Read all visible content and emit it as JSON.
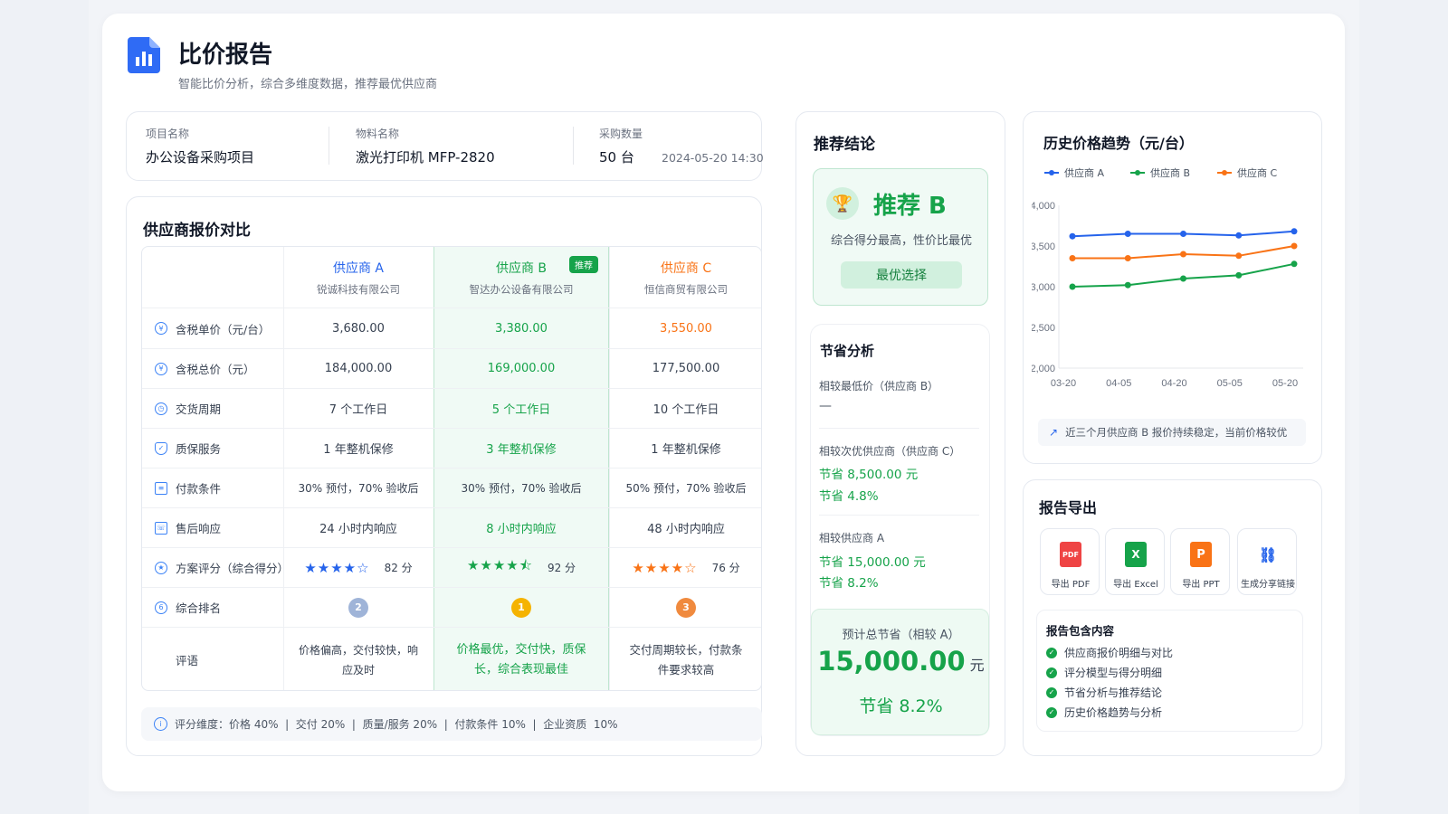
{
  "header": {
    "title": "比价报告",
    "subtitle": "智能比价分析，综合多维度数据，推荐最优供应商"
  },
  "project_info": {
    "project_label": "项目名称",
    "project_value": "办公设备采购项目",
    "material_label": "物料名称",
    "material_value": "激光打印机 MFP-2820",
    "qty_label": "采购数量",
    "qty_value": "50 台",
    "datetime": "2024-05-20 14:30"
  },
  "comparison": {
    "title": "供应商报价对比",
    "suppliers": [
      {
        "name": "供应商 A",
        "company": "锐诚科技有限公司"
      },
      {
        "name": "供应商 B",
        "company": "智达办公设备有限公司",
        "tag": "推荐"
      },
      {
        "name": "供应商 C",
        "company": "恒信商贸有限公司"
      }
    ],
    "rows": [
      {
        "label": "含税单价（元/台）",
        "icon": "money-icon",
        "a": "3,680.00",
        "b": "3,380.00",
        "c": "3,550.00"
      },
      {
        "label": "含税总价（元）",
        "icon": "money-icon",
        "a": "184,000.00",
        "b": "169,000.00",
        "c": "177,500.00"
      },
      {
        "label": "交货周期",
        "icon": "clock-icon",
        "a": "7 个工作日",
        "b": "5 个工作日",
        "c": "10 个工作日"
      },
      {
        "label": "质保服务",
        "icon": "shield-icon",
        "a": "1 年整机保修",
        "b": "3 年整机保修",
        "c": "1 年整机保修"
      },
      {
        "label": "付款条件",
        "icon": "document-icon",
        "a": "30% 预付，70% 验收后",
        "b": "30% 预付，70% 验收后",
        "c": "50% 预付，70% 验收后"
      },
      {
        "label": "售后响应",
        "icon": "support-icon",
        "a": "24 小时内响应",
        "b": "8 小时内响应",
        "c": "48 小时内响应"
      }
    ],
    "score_row": {
      "label": "方案评分（综合得分）",
      "a_stars": "★★★★☆",
      "a_score": "82 分",
      "b_stars": "★★★★⯪",
      "b_score": "92 分",
      "c_stars": "★★★★☆",
      "c_score": "76 分",
      "a_rating": 4,
      "b_rating": 4.5,
      "c_rating": 4
    },
    "rank_row": {
      "label": "综合排名",
      "a": "2",
      "b": "1",
      "c": "3"
    },
    "comment_row": {
      "label": "评语",
      "a": "价格偏高，交付较快，响应及时",
      "b": "价格最优，交付快，质保长，综合表现最佳",
      "c": "交付周期较长，付款条件要求较高"
    },
    "note": "评分维度：价格 40%  |  交付 20%  |  质量/服务 20%  |  付款条件 10%  |  企业资质  10%"
  },
  "recommendation": {
    "title": "推荐结论",
    "headline": "推荐 B",
    "reason": "综合得分最高，性价比最优",
    "button": "最优选择"
  },
  "savings": {
    "title": "节省分析",
    "items": [
      {
        "label": "相较最低价（供应商 B）",
        "line1": "—",
        "line2": ""
      },
      {
        "label": "相较次优供应商（供应商 C）",
        "line1": "节省 8,500.00 元",
        "line2": "节省 4.8%"
      },
      {
        "label": "相较供应商 A",
        "line1": "节省 15,000.00 元",
        "line2": "节省 8.2%"
      }
    ],
    "total_label": "预计总节省（相较 A）",
    "total_value": "15,000.00",
    "total_unit": "元",
    "total_pct": "节省 8.2%"
  },
  "trend": {
    "title": "历史价格趋势（元/台）",
    "note": "近三个月供应商 B 报价持续稳定，当前价格较优",
    "colors": {
      "A": "#2563eb",
      "B": "#16a34a",
      "C": "#f97316"
    }
  },
  "chart_data": {
    "type": "line",
    "title": "历史价格趋势（元/台）",
    "x": [
      "03-20",
      "04-05",
      "04-20",
      "05-05",
      "05-20"
    ],
    "series": [
      {
        "name": "供应商 A",
        "values": [
          3620,
          3650,
          3650,
          3630,
          3680
        ]
      },
      {
        "name": "供应商 B",
        "values": [
          3000,
          3020,
          3100,
          3140,
          3280
        ]
      },
      {
        "name": "供应商 C",
        "values": [
          3350,
          3350,
          3400,
          3380,
          3500
        ]
      }
    ],
    "yticks": [
      "4,000",
      "3,500",
      "3,000",
      "2,500",
      "2,000"
    ],
    "ylim": [
      2000,
      4000
    ],
    "legend": "top-left",
    "grid": false
  },
  "export": {
    "title": "报告导出",
    "buttons": [
      {
        "label": "导出 PDF",
        "icon": "pdf-icon",
        "badge": "PDF",
        "color": "#ef4444"
      },
      {
        "label": "导出 Excel",
        "icon": "excel-icon",
        "badge": "X",
        "color": "#16a34a"
      },
      {
        "label": "导出 PPT",
        "icon": "ppt-icon",
        "badge": "P",
        "color": "#f97316"
      },
      {
        "label": "生成分享链接",
        "icon": "link-icon",
        "badge": "🔗",
        "color": "#2563eb"
      }
    ],
    "includes_title": "报告包含内容",
    "includes": [
      "供应商报价明细与对比",
      "评分模型与得分明细",
      "节省分析与推荐结论",
      "历史价格趋势与分析"
    ]
  }
}
